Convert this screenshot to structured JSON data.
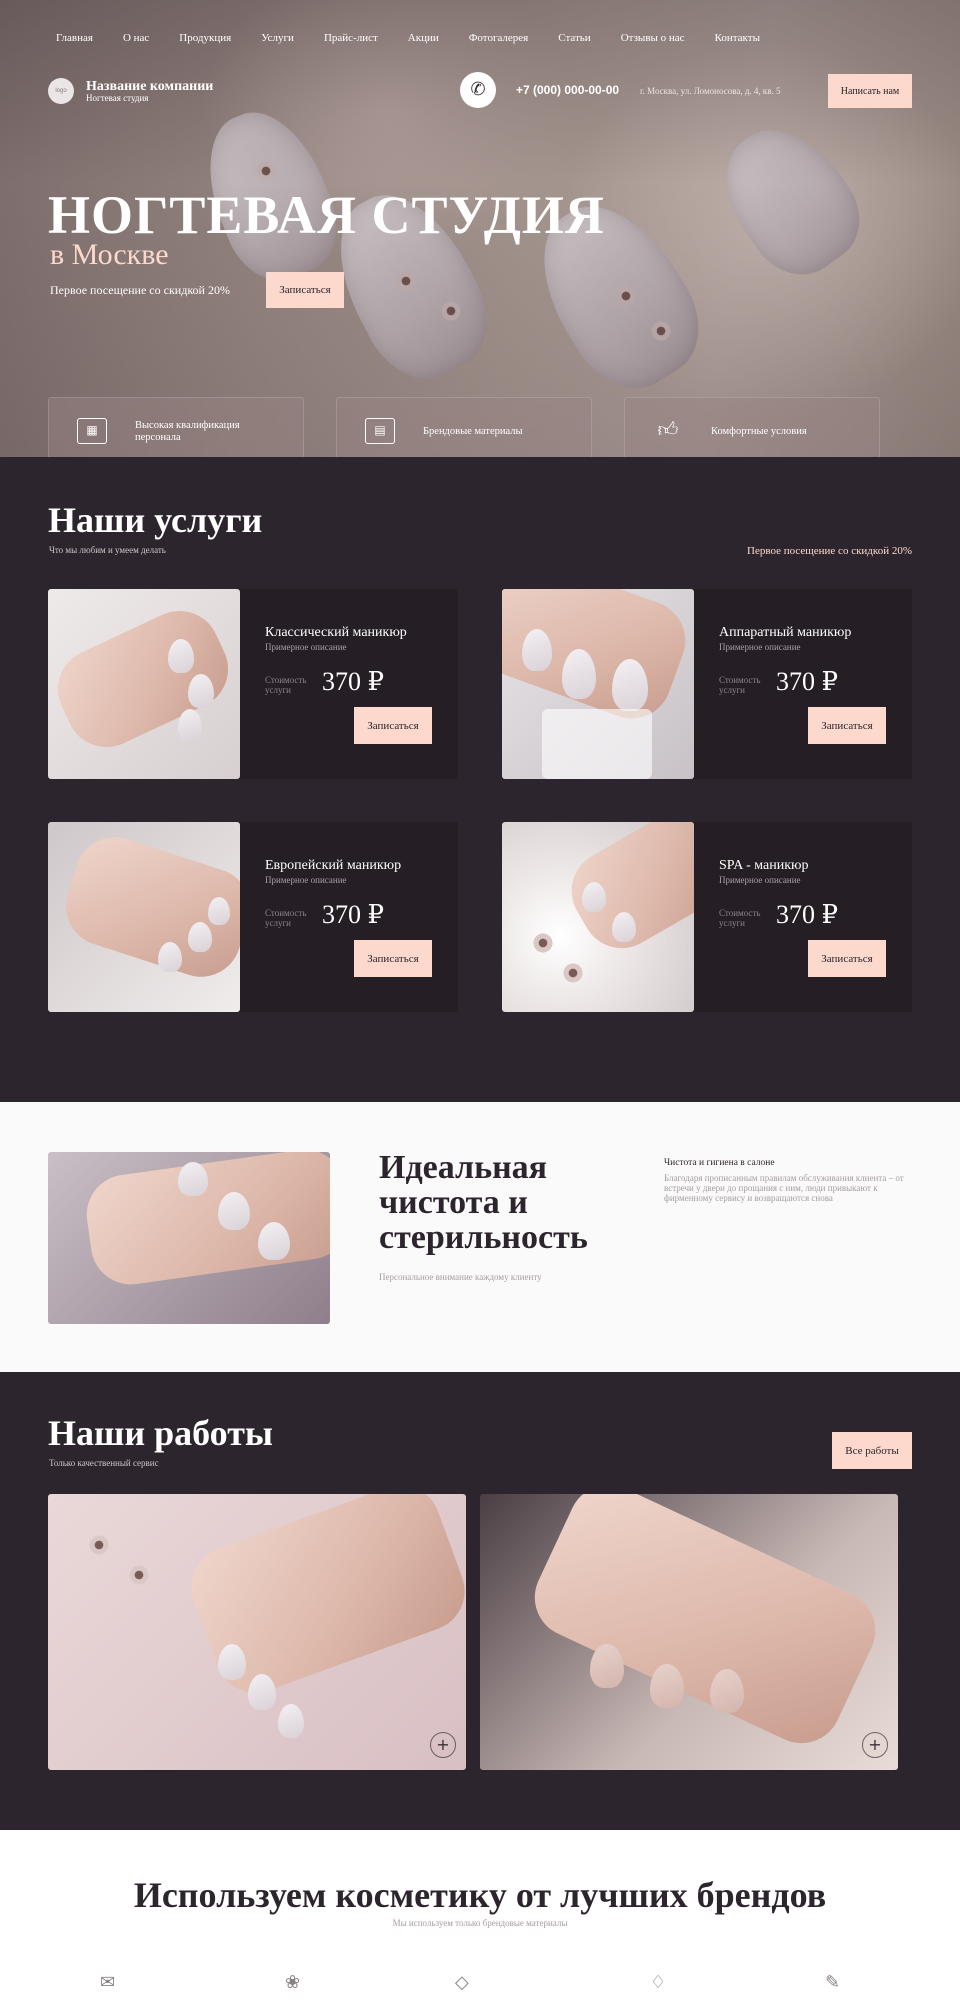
{
  "nav": [
    "Главная",
    "О нас",
    "Продукция",
    "Услуги",
    "Прайс-лист",
    "Акции",
    "Фотогалерея",
    "Статьи",
    "Отзывы о нас",
    "Контакты"
  ],
  "header": {
    "logo_text": "logo",
    "company_name": "Название компании",
    "company_sub": "Ногтевая студия",
    "phone_icon": "phone-icon",
    "phone": "+7 (000) 000-00-00",
    "address": "г. Москва, ул. Ломоносова, д. 4, кв. 5",
    "write_label": "Написать нам"
  },
  "hero": {
    "title": "НОГТЕВАЯ СТУДИЯ",
    "subtitle": "в Москве",
    "promo": "Первое посещение со скидкой 20%",
    "button": "Записаться"
  },
  "features": [
    {
      "icon": "certificate-icon",
      "text": "Высокая квалификация персонала"
    },
    {
      "icon": "diploma-icon",
      "text": "Брендовые материалы"
    },
    {
      "icon": "thumbs-up-icon",
      "text": "Комфортные условия"
    }
  ],
  "services": {
    "title": "Наши услуги",
    "subtitle": "Что мы любим и умеем делать",
    "promo": "Первое посещение со скидкой 20%",
    "cost_label": "Стоимость услуги",
    "button": "Записаться",
    "items": [
      {
        "name": "Классический маникюр",
        "desc": "Примерное описание",
        "price": "370 ₽"
      },
      {
        "name": "Аппаратный маникюр",
        "desc": "Примерное описание",
        "price": "370 ₽"
      },
      {
        "name": "Европейский маникюр",
        "desc": "Примерное описание",
        "price": "370 ₽"
      },
      {
        "name": "SPA - маникюр",
        "desc": "Примерное описание",
        "price": "370 ₽"
      }
    ]
  },
  "clean": {
    "title": "Идеальная чистота и стерильность",
    "caption": "Персональное внимание каждому клиенту",
    "heading": "Чистота и гигиена в салоне",
    "text": "Благодаря прописанным правилам обслуживания клиента – от встречи у двери до прощания с ним, люди привыкают к фирменному сервису и возвращаются снова"
  },
  "works": {
    "title": "Наши работы",
    "subtitle": "Только качественный сервис",
    "button": "Все работы",
    "plus": "+"
  },
  "brands": {
    "title": "Используем косметику от лучших брендов",
    "subtitle": "Мы используем только брендовые материалы"
  },
  "colors": {
    "dark": "#2d252d",
    "card": "#251e25",
    "accent": "#fcd9cc"
  }
}
